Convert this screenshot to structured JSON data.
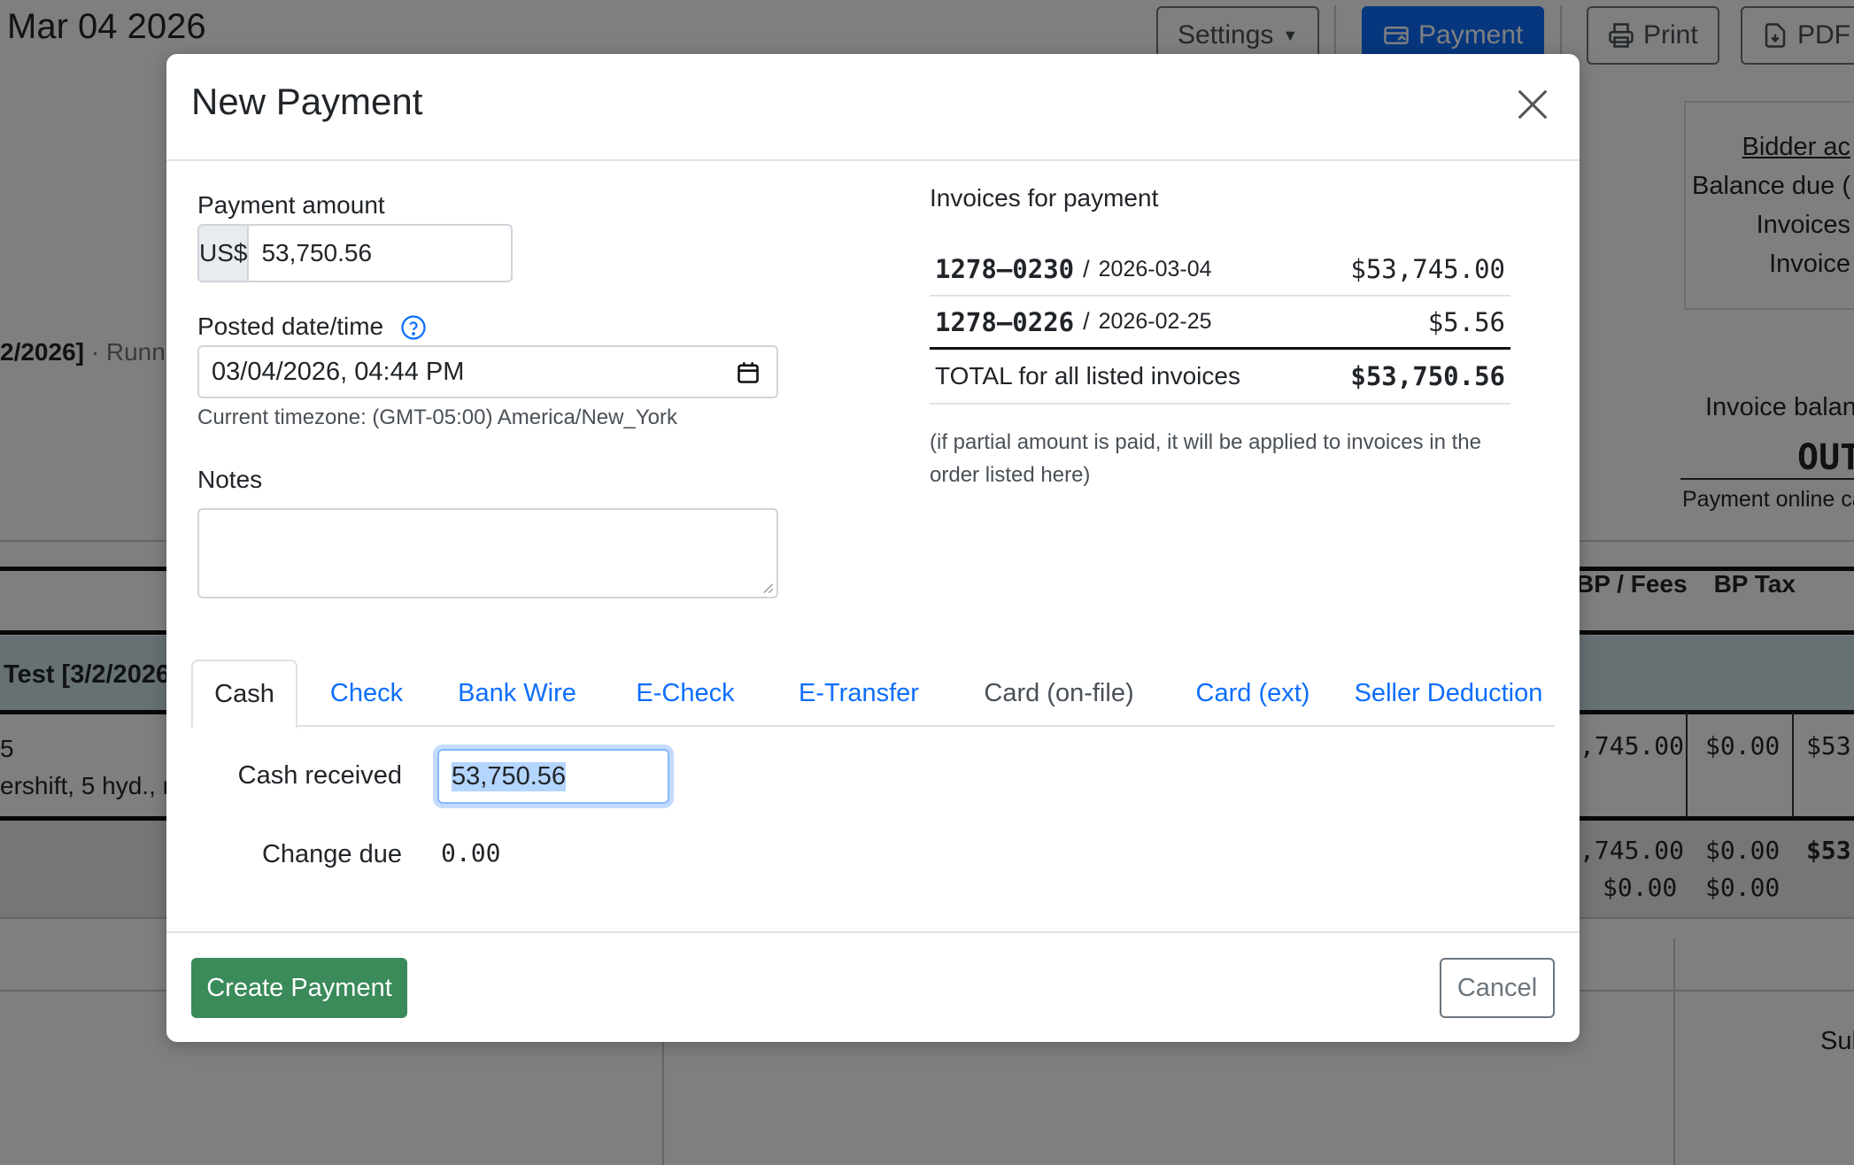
{
  "background": {
    "date": "Mar 04 2026",
    "buttons": {
      "settings": "Settings",
      "payment": "Payment",
      "print": "Print",
      "pdf": "PDF"
    },
    "run_date": "2/2026]",
    "run_text": "Runn",
    "summary": {
      "bidder": "Bidder ac",
      "balance_due": "Balance due (",
      "invoices": "Invoices",
      "invoice": "Invoice"
    },
    "invoice_balance": "Invoice balanc",
    "out": "OUT",
    "payment_online": "Payment online ca",
    "headers": {
      "bp_fees": "BP / Fees",
      "bp_tax": "BP Tax"
    },
    "group": "Test [3/2/2026",
    "item_line1": "5",
    "item_line2": "ershift, 5 hyd., r",
    "row1": {
      "fees": ",745.00",
      "tax": "$0.00",
      "total": "$53"
    },
    "foot1": {
      "fees": ",745.00",
      "tax": "$0.00",
      "total": "$53"
    },
    "foot2": {
      "fees": "$0.00",
      "tax": "$0.00"
    },
    "sub": "Sub"
  },
  "modal": {
    "title": "New Payment",
    "payment_amount": {
      "label": "Payment amount",
      "currency": "US$",
      "value": "53,750.56"
    },
    "posted": {
      "label": "Posted date/time",
      "value": "03/04/2026, 04:44  PM",
      "timezone": "Current timezone: (GMT-05:00) America/New_York"
    },
    "notes": {
      "label": "Notes",
      "value": ""
    },
    "invoices": {
      "title": "Invoices for payment",
      "rows": [
        {
          "number": "1278–0230",
          "date": "2026-03-04",
          "amount": "$53,745.00"
        },
        {
          "number": "1278–0226",
          "date": "2026-02-25",
          "amount": "$5.56"
        }
      ],
      "total_label": "TOTAL for all listed invoices",
      "total_amount": "$53,750.56",
      "note": "(if partial amount is paid, it will be applied to invoices in the order listed here)"
    },
    "tabs": [
      "Cash",
      "Check",
      "Bank Wire",
      "E-Check",
      "E-Transfer",
      "Card (on-file)",
      "Card (ext)",
      "Seller Deduction"
    ],
    "cash": {
      "received_label": "Cash received",
      "received_value": "53,750.56",
      "change_label": "Change due",
      "change_value": "0.00"
    },
    "create_label": "Create Payment",
    "cancel_label": "Cancel"
  }
}
